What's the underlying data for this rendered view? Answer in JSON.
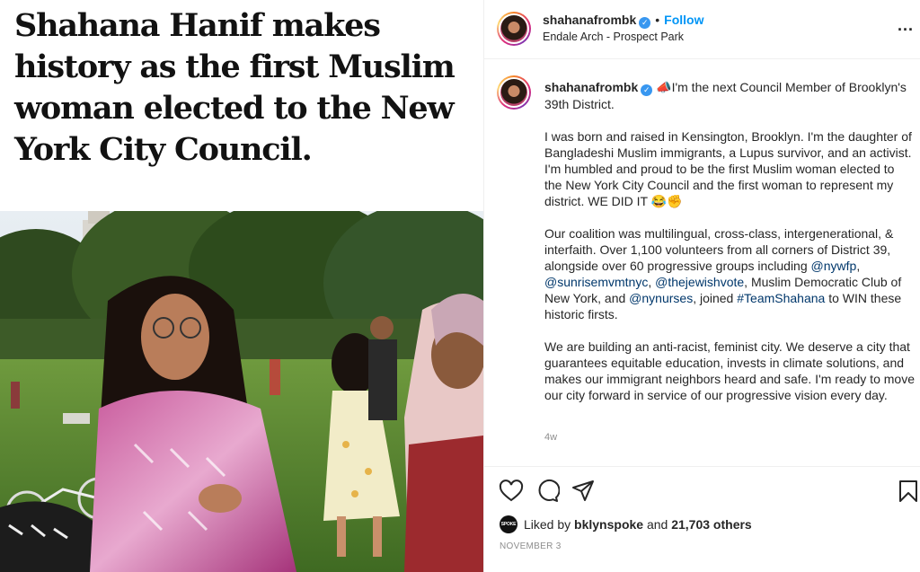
{
  "media": {
    "headline": "Shahana Hanif makes history as the first Muslim woman elected to the New York City Council."
  },
  "header": {
    "username": "shahanafrombk",
    "follow_label": "Follow",
    "separator": "•",
    "location": "Endale Arch - Prospect Park",
    "more_label": "..."
  },
  "caption": {
    "username": "shahanafrombk",
    "intro": "📣I'm the next Council Member of Brooklyn's 39th District.",
    "p1": "I was born and raised in Kensington, Brooklyn. I'm the daughter of Bangladeshi Muslim immigrants, a Lupus survivor, and an activist. I'm humbled and proud to be the first Muslim woman elected to the New York City Council and the first woman to represent my district. WE DID IT 😂✊",
    "p2_a": "Our coalition was multilingual, cross-class, intergenerational, & interfaith. Over 1,100 volunteers from all corners of District 39, alongside over 60 progressive groups including ",
    "mention_1": "@nywfp",
    "comma_1": ", ",
    "mention_2": "@sunrisemvmtnyc",
    "comma_2": ", ",
    "mention_3": "@thejewishvote",
    "p2_b": ", Muslim Democratic Club of New York, and ",
    "mention_4": "@nynurses",
    "p2_c": ", joined ",
    "hashtag": "#TeamShahana",
    "p2_d": " to WIN these historic firsts.",
    "p3": "We are building an anti-racist, feminist city. We deserve a city that guarantees equitable education, invests in climate solutions, and makes our immigrant neighbors heard and safe. I'm ready to move our city forward in service of our progressive vision every day.",
    "time": "4w"
  },
  "actions": {
    "like_icon": "heart-icon",
    "comment_icon": "comment-icon",
    "share_icon": "paper-plane-icon",
    "save_icon": "bookmark-icon",
    "liker_avatar_text": "SPOKE",
    "likes_prefix": "Liked by ",
    "liker": "bklynspoke",
    "likes_mid": " and ",
    "likes_count": "21,703 others",
    "date": "NOVEMBER 3"
  },
  "colors": {
    "link": "#00376b",
    "follow": "#0095f6",
    "verified": "#3897f0"
  }
}
